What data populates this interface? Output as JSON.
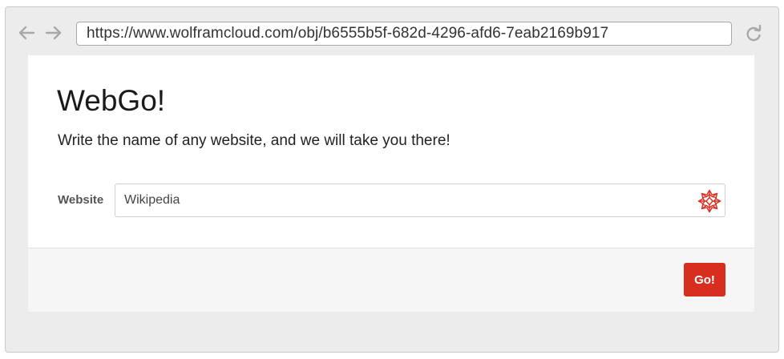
{
  "browser": {
    "url": "https://www.wolframcloud.com/obj/b6555b5f-682d-4296-afd6-7eab2169b917",
    "icons": {
      "back": "arrow-left-icon",
      "forward": "arrow-right-icon",
      "reload": "reload-icon"
    }
  },
  "page": {
    "title": "WebGo!",
    "subtitle": "Write the name of any website, and we will take you there!"
  },
  "form": {
    "field_label": "Website",
    "field_value": "Wikipedia",
    "field_icon": "wolfram-spikey-icon",
    "submit_label": "Go!"
  },
  "colors": {
    "accent": "#d72e1f",
    "window_chrome": "#ececec",
    "footer_bg": "#f6f6f6"
  }
}
